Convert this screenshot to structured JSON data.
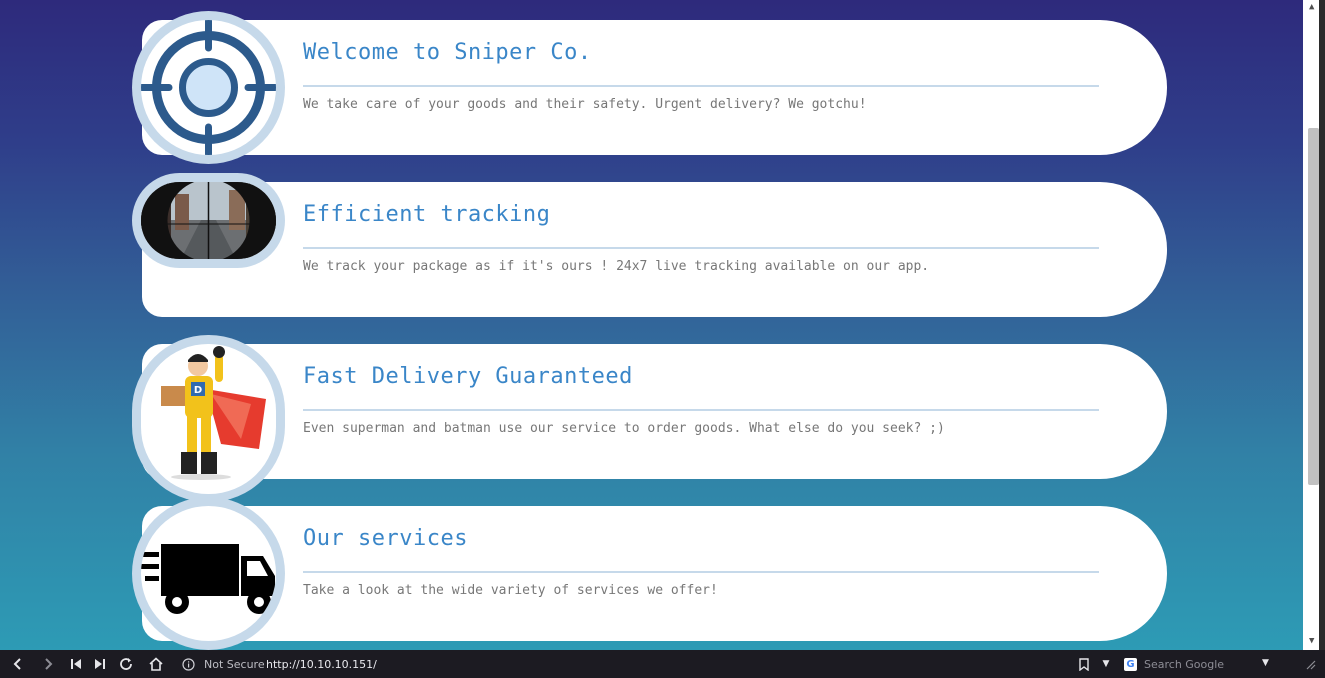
{
  "cards": [
    {
      "title": "Welcome to Sniper Co.",
      "description": "We take care of your goods and their safety. Urgent delivery? We gotchu!"
    },
    {
      "title": "Efficient tracking",
      "description": "We track your package as if it's ours ! 24x7 live tracking available on our app."
    },
    {
      "title": "Fast Delivery Guaranteed",
      "description": "Even superman and batman use our service to order goods. What else do you seek? ;)"
    },
    {
      "title": "Our services",
      "description": "Take a look at the wide variety of services we offer!"
    }
  ],
  "icons": [
    "crosshair-icon",
    "scope-view-image",
    "delivery-hero-image",
    "truck-icon"
  ],
  "browser": {
    "security_label": "Not Secure",
    "url": "http://10.10.10.151/",
    "search_placeholder": "Search Google"
  },
  "colors": {
    "title": "#3a86c8",
    "accent_ring": "#c6d9ea",
    "gradient_top": "#2e2a7c",
    "gradient_bottom": "#2d9bb5"
  }
}
